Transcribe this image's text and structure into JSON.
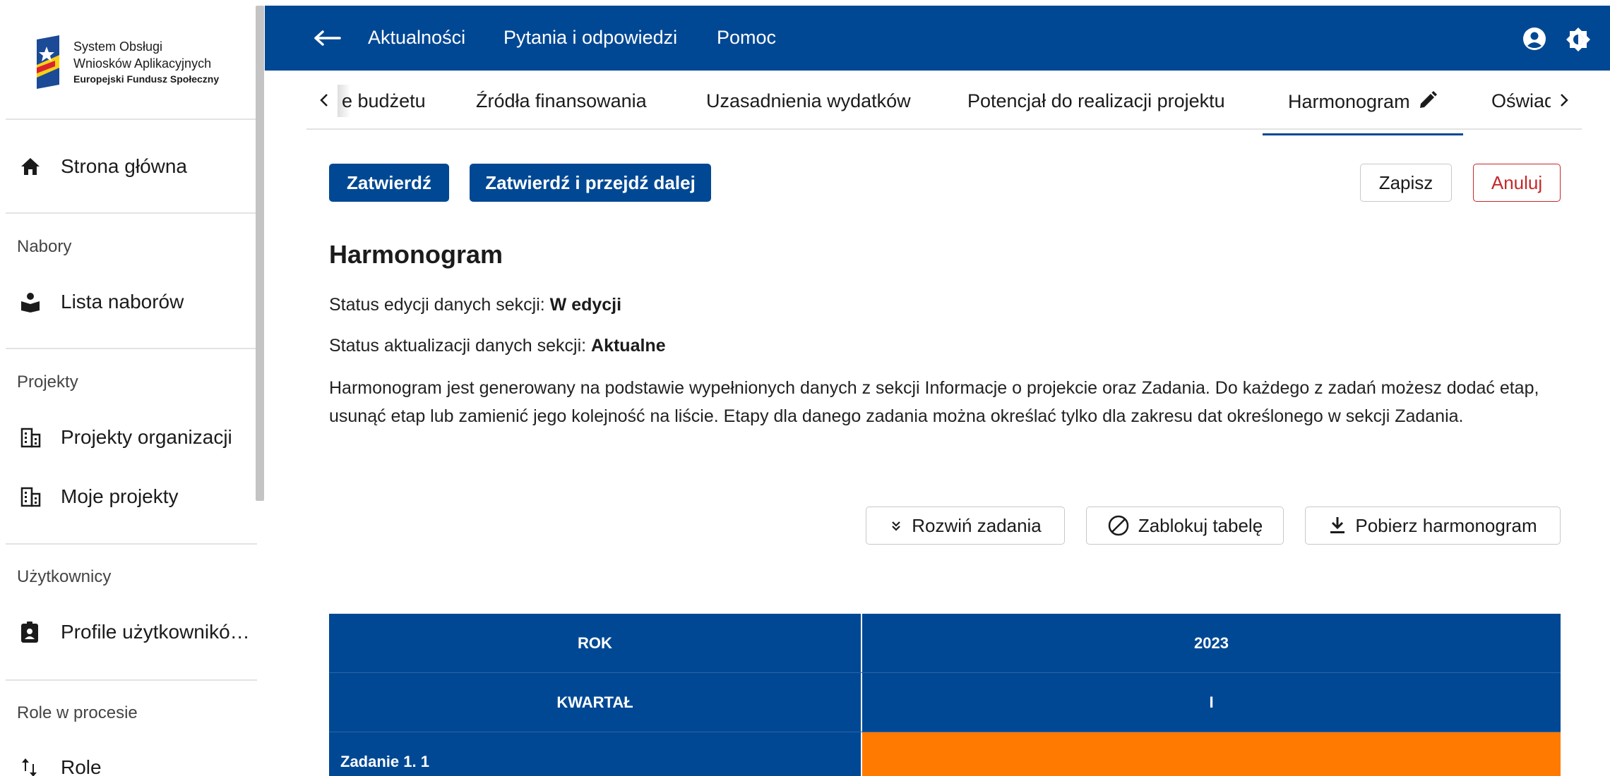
{
  "app": {
    "logo": {
      "line1": "System Obsługi",
      "line2": "Wniosków Aplikacyjnych",
      "line3": "Europejski Fundusz Społeczny"
    }
  },
  "sidebar": {
    "home": "Strona główna",
    "sections": [
      {
        "title": "Nabory",
        "items": [
          "Lista naborów"
        ]
      },
      {
        "title": "Projekty",
        "items": [
          "Projekty organizacji",
          "Moje projekty"
        ]
      },
      {
        "title": "Użytkownicy",
        "items": [
          "Profile użytkownikó…"
        ]
      },
      {
        "title": "Role w procesie",
        "items": [
          "Role"
        ]
      }
    ]
  },
  "topbar": {
    "links": [
      "Aktualności",
      "Pytania i odpowiedzi",
      "Pomoc"
    ]
  },
  "tabs": {
    "items": [
      "e budżetu",
      "Źródła finansowania",
      "Uzasadnienia wydatków",
      "Potencjał do realizacji projektu",
      "Harmonogram",
      "Oświad"
    ],
    "active": "Harmonogram"
  },
  "actions": {
    "confirm": "Zatwierdź",
    "confirm_next": "Zatwierdź i przejdź dalej",
    "save": "Zapisz",
    "cancel": "Anuluj"
  },
  "section": {
    "title": "Harmonogram",
    "status_edit_label": "Status edycji danych sekcji:",
    "status_edit_value": "W edycji",
    "status_update_label": "Status aktualizacji danych sekcji:",
    "status_update_value": "Aktualne",
    "description": "Harmonogram jest generowany na podstawie wypełnionych danych z sekcji Informacje o projekcie oraz Zadania. Do każdego z zadań możesz dodać etap, usunąć etap lub zamienić jego kolejność na liście. Etapy dla danego zadania można określać tylko dla zakresu dat określonego w sekcji Zadania."
  },
  "table_actions": {
    "expand": "Rozwiń zadania",
    "lock": "Zablokuj tabelę",
    "download": "Pobierz harmonogram"
  },
  "table": {
    "year_label": "ROK",
    "year_value": "2023",
    "quarter_label": "KWARTAŁ",
    "quarter_value": "I",
    "task": "Zadanie 1. 1"
  },
  "colors": {
    "primary": "#014894",
    "cancel": "#c62828",
    "task_bar": "#ff7a00"
  }
}
